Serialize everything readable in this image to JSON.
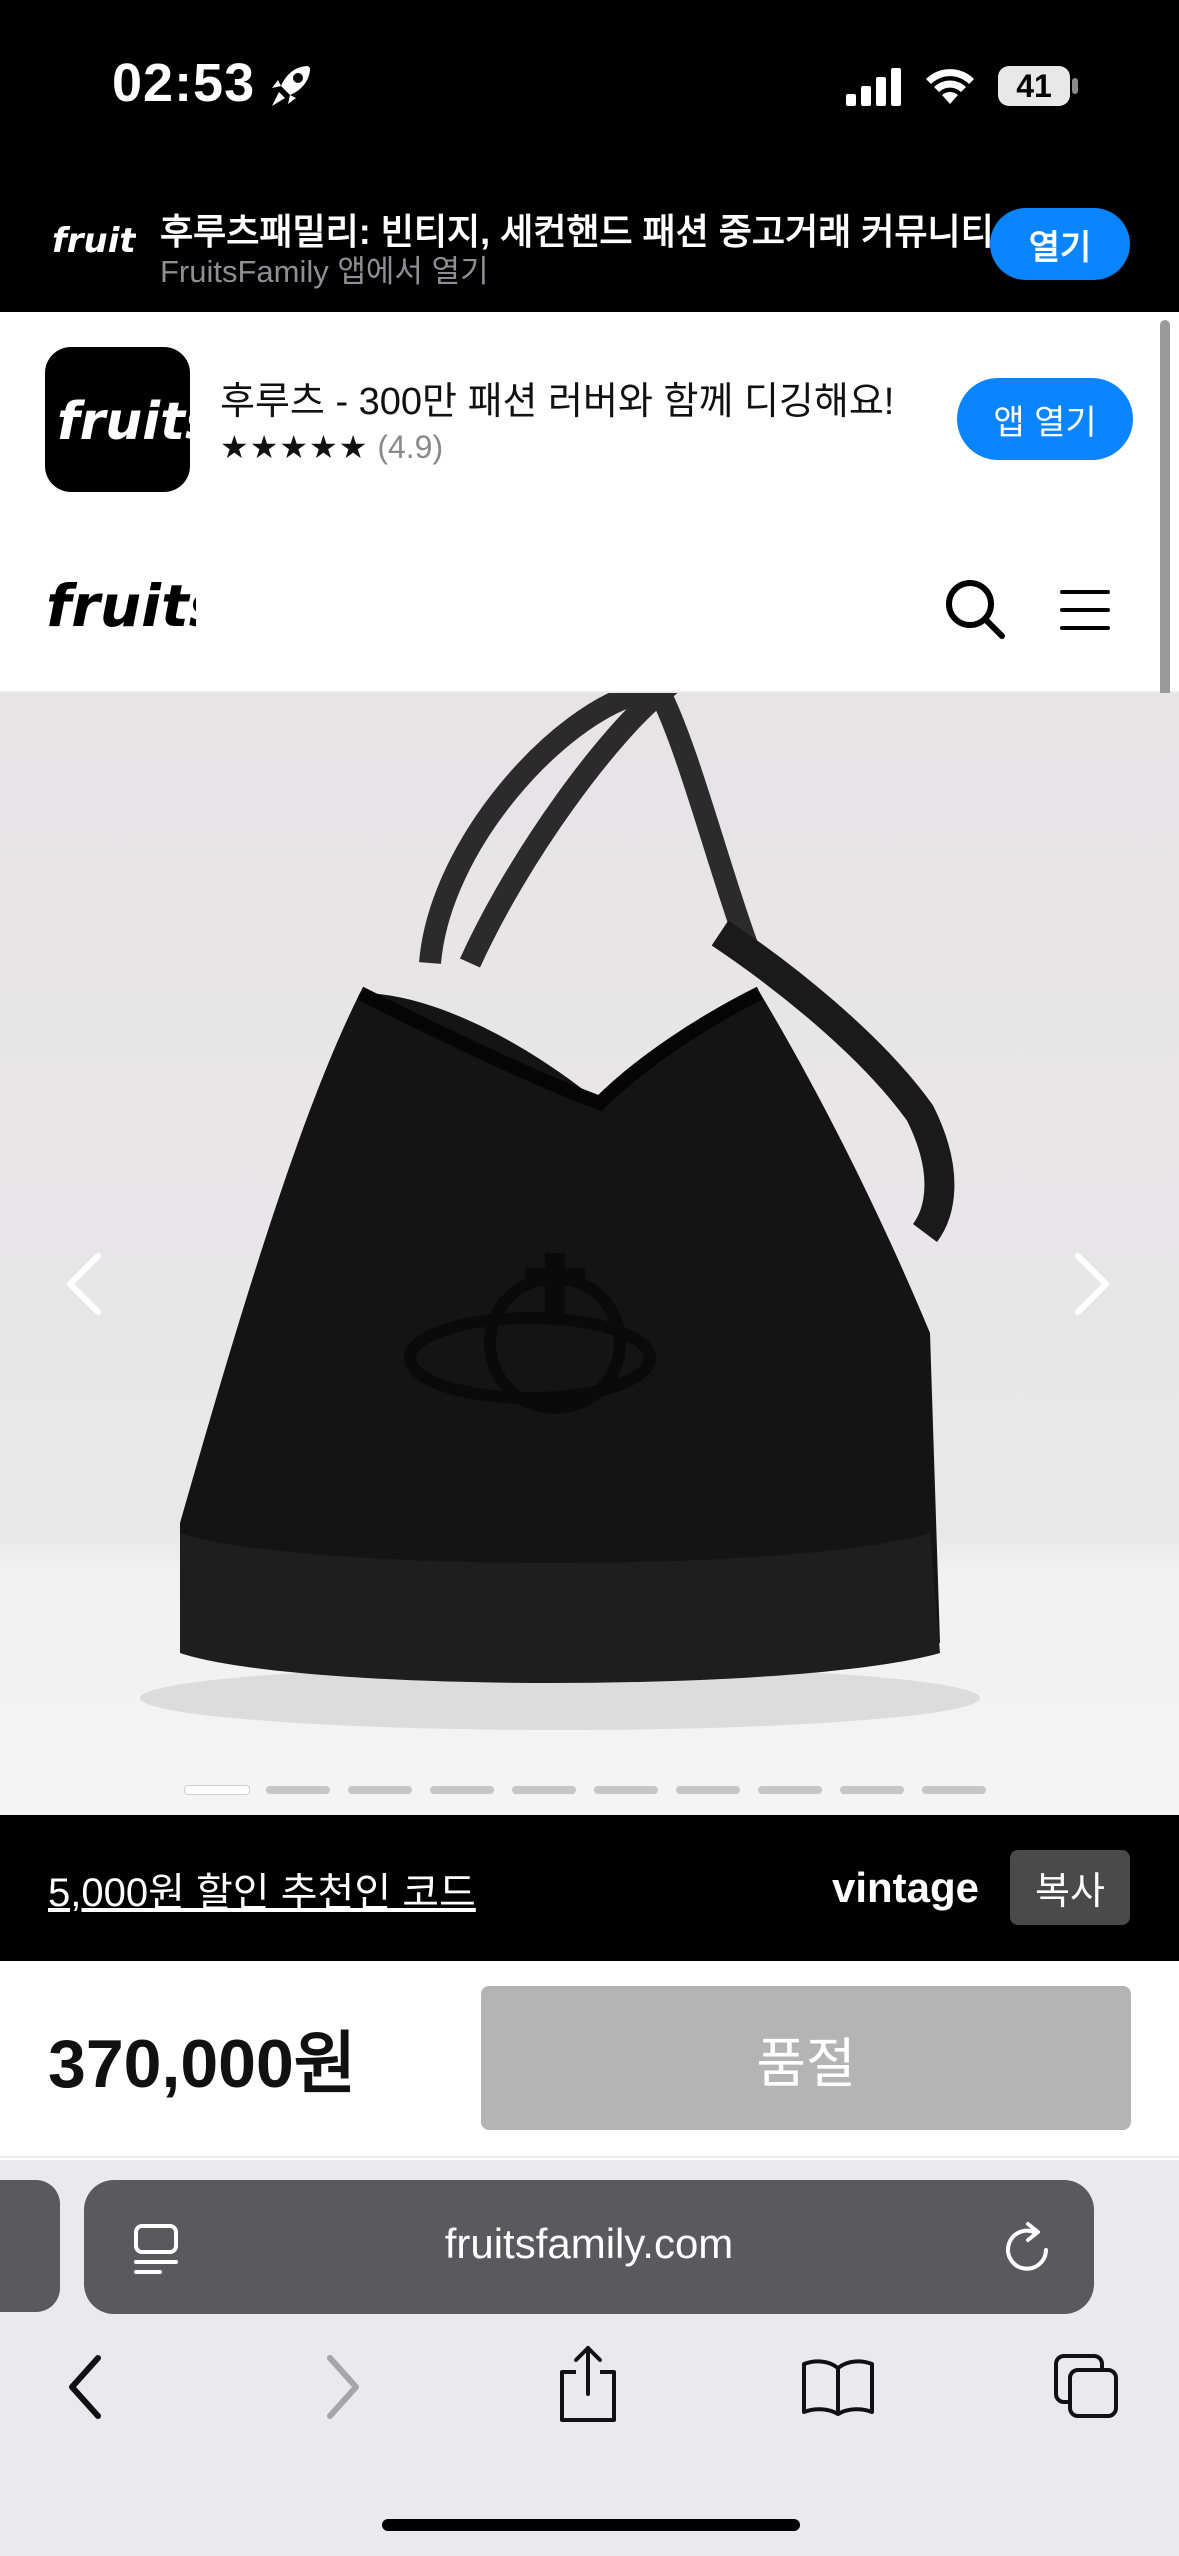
{
  "status_bar": {
    "time": "02:53",
    "battery": "41"
  },
  "smart_banner": {
    "title": "후루츠패밀리: 빈티지, 세컨핸드 패션 중고거래 커뮤니티",
    "subtitle": "FruitsFamily 앱에서 열기",
    "open_label": "열기"
  },
  "app_promo": {
    "name": "후루츠 - 300만 패션 러버와 함께 디깅해요!",
    "stars": "★★★★★",
    "rating": "(4.9)",
    "open_label": "앱 열기"
  },
  "header": {
    "logo": "fruits",
    "search_icon": "search-icon",
    "menu_icon": "menu-icon"
  },
  "product": {
    "image_count": 10,
    "active_image_index": 0
  },
  "promo": {
    "link_text": "5,000원 할인 추천인 코드",
    "code": "vintage",
    "copy_label": "복사"
  },
  "purchase": {
    "price": "370,000원",
    "status_label": "품절"
  },
  "browser": {
    "url": "fruitsfamily.com"
  },
  "colors": {
    "accent": "#0a84ff",
    "sold_out": "#b4b4b4",
    "dark": "#000000"
  }
}
